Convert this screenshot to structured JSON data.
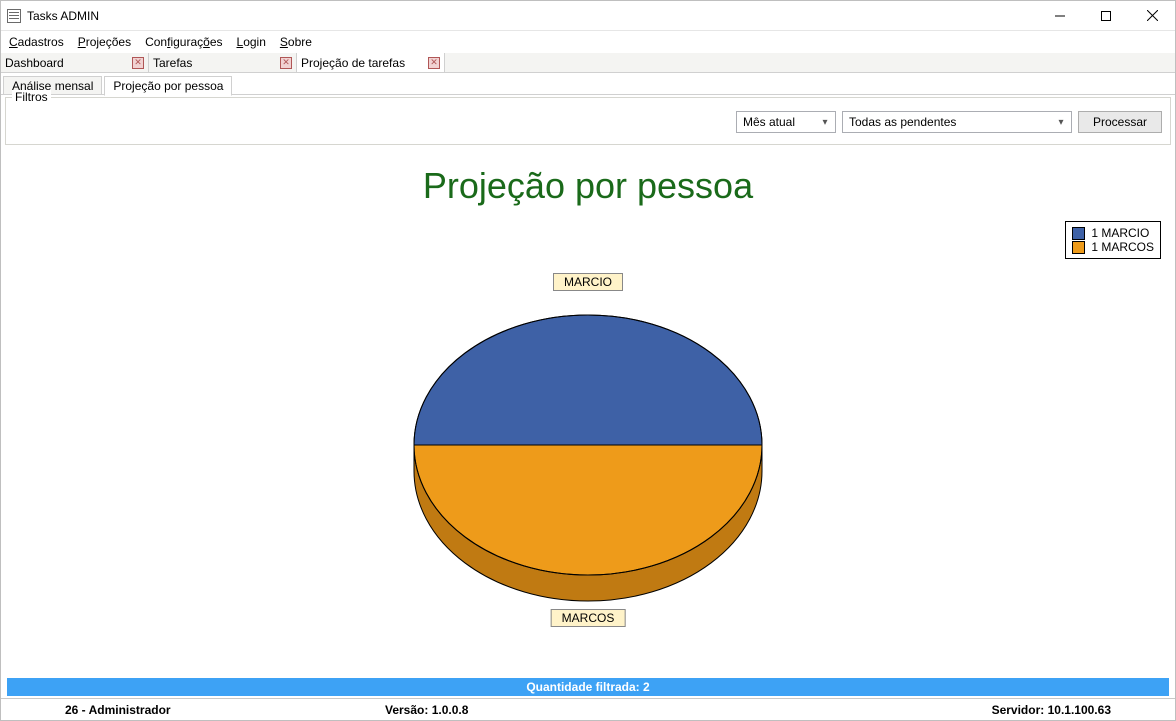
{
  "window": {
    "title": "Tasks ADMIN"
  },
  "menubar": {
    "items": [
      "Cadastros",
      "Projeções",
      "Configurações",
      "Login",
      "Sobre"
    ]
  },
  "doctabs": [
    {
      "label": "Dashboard"
    },
    {
      "label": "Tarefas"
    },
    {
      "label": "Projeção de tarefas"
    }
  ],
  "subtabs": [
    {
      "label": "Análise mensal",
      "active": false
    },
    {
      "label": "Projeção por pessoa",
      "active": true
    }
  ],
  "filters": {
    "legend": "Filtros",
    "period_selected": "Mês atual",
    "status_selected": "Todas as pendentes",
    "process_label": "Processar"
  },
  "chart_data": {
    "type": "pie",
    "title": "Projeção por pessoa",
    "series": [
      {
        "name": "MARCIO",
        "value": 1,
        "color": "#3e61a6",
        "legend_label": "1 MARCIO"
      },
      {
        "name": "MARCOS",
        "value": 1,
        "color": "#ee9b1a",
        "legend_label": "1 MARCOS"
      }
    ]
  },
  "filter_status": "Quantidade filtrada: 2",
  "statusbar": {
    "user": "26 - Administrador",
    "version": "Versão: 1.0.0.8",
    "server": "Servidor: 10.1.100.63"
  }
}
